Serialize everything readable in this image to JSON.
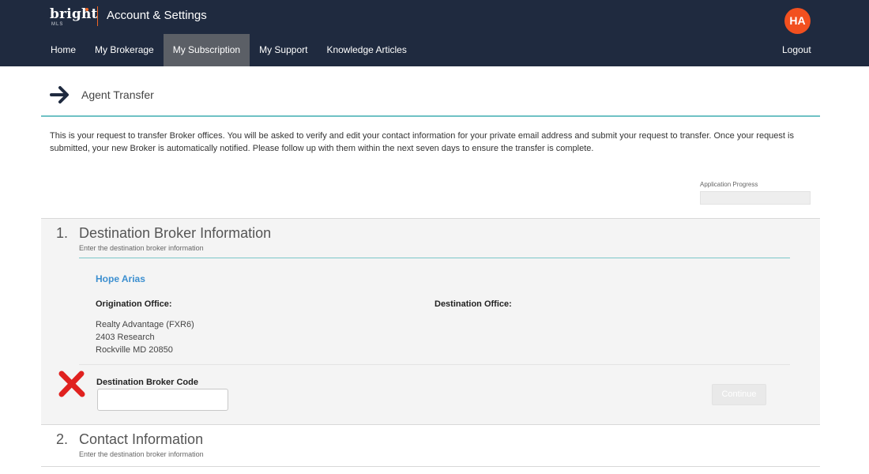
{
  "header": {
    "logo_text": "bright",
    "logo_sub": "MLS",
    "title": "Account & Settings",
    "avatar_initials": "HA",
    "brand_color": "#1f2a3f",
    "accent_color": "#f26522"
  },
  "nav": {
    "items": [
      {
        "label": "Home"
      },
      {
        "label": "My Brokerage"
      },
      {
        "label": "My Subscription",
        "active": true
      },
      {
        "label": "My Support"
      },
      {
        "label": "Knowledge Articles"
      }
    ],
    "logout_label": "Logout"
  },
  "page": {
    "title": "Agent Transfer",
    "icon": "arrow-right-icon",
    "intro": "This is your request to transfer Broker offices. You will be asked to verify and edit your contact information for your private email address and submit your request to transfer. Once your request is submitted, your new Broker is automatically notified. Please follow up with them within the next seven days to ensure the transfer is complete."
  },
  "progress": {
    "label": "Application Progress",
    "fraction": 0.0
  },
  "section1": {
    "number": "1.",
    "title": "Destination Broker Information",
    "subtitle": "Enter the destination broker information",
    "agent_name": "Hope Arias",
    "origination_label": "Origination Office:",
    "destination_label": "Destination Office:",
    "origination_address": [
      "Realty Advantage (FXR6)",
      "2403 Research",
      "Rockville MD 20850"
    ],
    "code_label": "Destination Broker Code",
    "code_value": "",
    "code_placeholder": "",
    "continue_label": "Continue",
    "error_icon": "red-x-icon"
  },
  "section2": {
    "number": "2.",
    "title": "Contact Information",
    "subtitle": "Enter the destination broker information"
  }
}
